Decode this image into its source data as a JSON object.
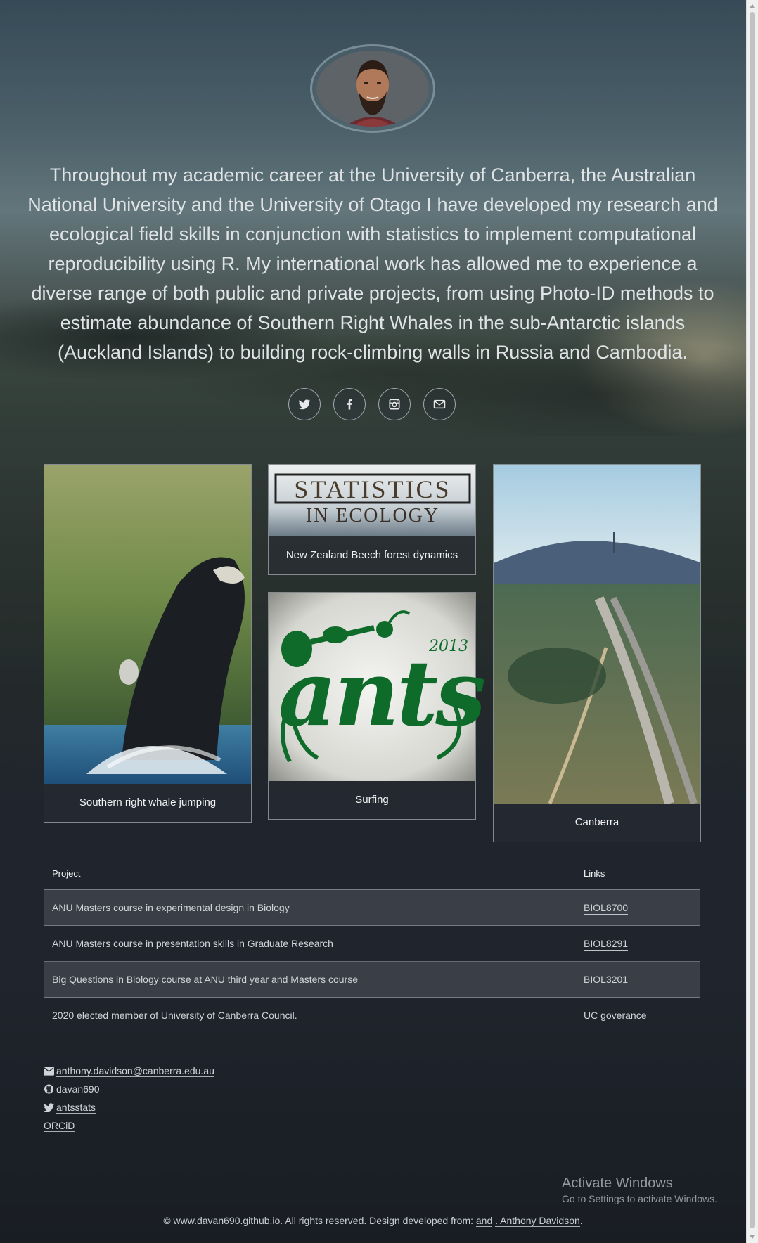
{
  "profile": {
    "avatar_alt": "Anthony Davidson portrait",
    "bio": "Throughout my academic career at the University of Canberra, the Australian National University and the University of Otago I have developed my research and ecological field skills in conjunction with statistics to implement computational reproducibility using R. My international work has allowed me to experience a diverse range of both public and private projects, from using Photo-ID methods to estimate abundance of Southern Right Whales in the sub-Antarctic islands (Auckland Islands) to building rock-climbing walls in Russia and Cambodia."
  },
  "socials": [
    {
      "icon": "twitter-icon"
    },
    {
      "icon": "facebook-icon"
    },
    {
      "icon": "instagram-icon"
    },
    {
      "icon": "envelope-icon"
    }
  ],
  "cards": {
    "whale": {
      "caption": "Southern right whale jumping"
    },
    "statistics": {
      "title_line1": "STATISTICS",
      "title_line2": "IN ECOLOGY",
      "caption": "New Zealand Beech forest dynamics"
    },
    "ants": {
      "logo_text": "ants",
      "logo_year": "2013",
      "caption": "Surfing"
    },
    "canberra": {
      "caption": "Canberra"
    }
  },
  "table": {
    "headers": {
      "project": "Project",
      "links": "Links"
    },
    "rows": [
      {
        "project": "ANU Masters course in experimental design in Biology",
        "link": "BIOL8700"
      },
      {
        "project": "ANU Masters course in presentation skills in Graduate Research",
        "link": "BIOL8291"
      },
      {
        "project": "Big Questions in Biology course at ANU third year and Masters course",
        "link": "BIOL3201"
      },
      {
        "project": "2020 elected member of University of Canberra Council.",
        "link": "UC goverance"
      }
    ]
  },
  "contacts": {
    "email": "anthony.davidson@canberra.edu.au",
    "github": "davan690",
    "twitter": "antsstats",
    "orcid": "ORCiD"
  },
  "footer": {
    "prefix": "© www.davan690.github.io. All rights reserved. Design developed from: ",
    "link1": "and",
    "middle": " ",
    "link2": ". Anthony Davidson",
    "suffix": "."
  },
  "watermark": {
    "title": "Activate Windows",
    "subtitle": "Go to Settings to activate Windows."
  }
}
